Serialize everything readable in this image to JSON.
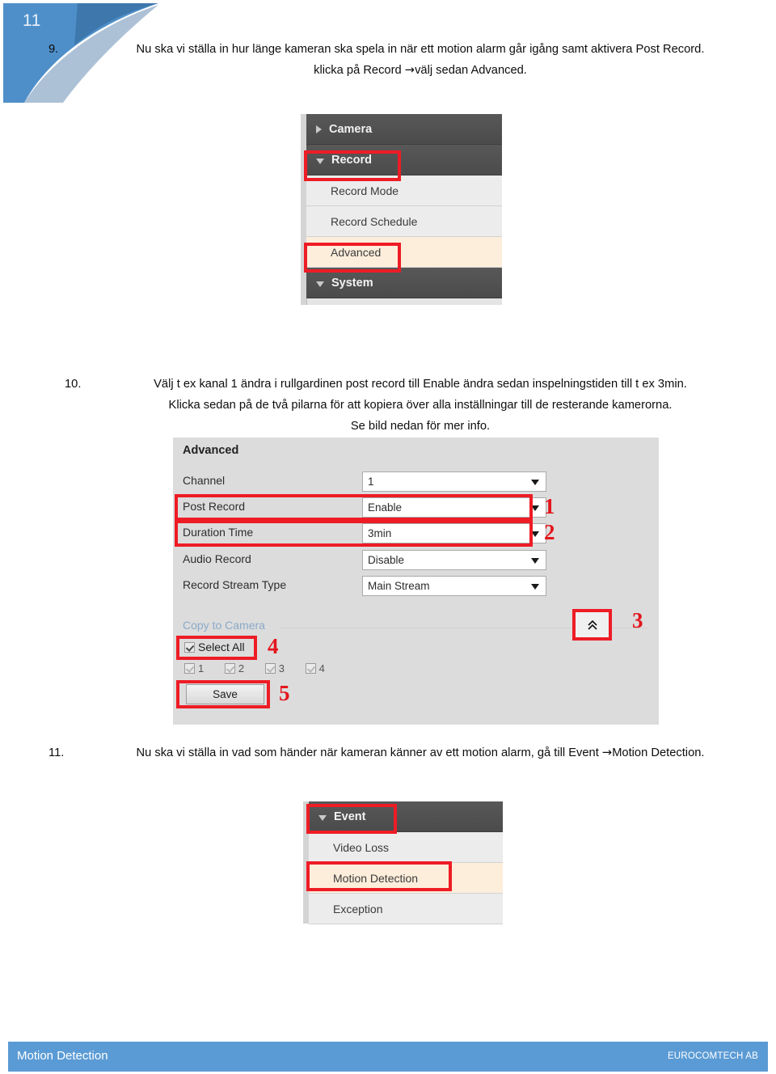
{
  "page": {
    "slide_number": "11"
  },
  "steps": {
    "nine": {
      "number": "9.",
      "line1": "Nu ska vi ställa in hur länge kameran ska spela in när ett motion alarm går igång samt aktivera Post Record.",
      "line2_before": "klicka på Record ",
      "line2_arrow": "→",
      "line2_after": "välj sedan Advanced."
    },
    "ten": {
      "number": "10.",
      "line1": "Välj t ex kanal 1 ändra i rullgardinen post record till Enable ändra sedan inspelningstiden till t ex 3min.",
      "line2": "Klicka sedan på de två pilarna för att kopiera över alla inställningar till de resterande kamerorna.",
      "line3": "Se bild nedan för mer info."
    },
    "eleven": {
      "number": "11.",
      "line1_before": "Nu ska vi ställa in vad som händer när kameran känner av ett motion alarm, gå till Event ",
      "line1_arrow": "→",
      "line1_after": "Motion Detection."
    }
  },
  "record_menu": {
    "items": [
      {
        "label": "Camera",
        "type": "group",
        "arrow": "right-triangle-icon",
        "highlighted": false
      },
      {
        "label": "Record",
        "type": "group",
        "arrow": "down-triangle-icon",
        "highlighted": true
      },
      {
        "label": "Record Mode",
        "type": "leaf",
        "active": false,
        "highlighted": false
      },
      {
        "label": "Record Schedule",
        "type": "leaf",
        "active": false,
        "highlighted": false
      },
      {
        "label": "Advanced",
        "type": "leaf",
        "active": true,
        "highlighted": true
      },
      {
        "label": "System",
        "type": "group",
        "arrow": "down-triangle-icon",
        "highlighted": false
      }
    ]
  },
  "event_menu": {
    "items": [
      {
        "label": "Event",
        "type": "group",
        "arrow": "down-triangle-icon",
        "highlighted": true
      },
      {
        "label": "Video Loss",
        "type": "leaf",
        "active": false,
        "highlighted": false
      },
      {
        "label": "Motion Detection",
        "type": "leaf",
        "active": true,
        "highlighted": true
      },
      {
        "label": "Exception",
        "type": "leaf",
        "active": false,
        "highlighted": false
      }
    ]
  },
  "advanced_dialog": {
    "title": "Advanced",
    "fields": [
      {
        "label": "Channel",
        "value": "1",
        "highlighted": false
      },
      {
        "label": "Post Record",
        "value": "Enable",
        "highlighted": true
      },
      {
        "label": "Duration Time",
        "value": "3min",
        "highlighted": true
      },
      {
        "label": "Audio Record",
        "value": "Disable",
        "highlighted": false
      },
      {
        "label": "Record Stream Type",
        "value": "Main Stream",
        "highlighted": false
      }
    ],
    "copy_to_camera_label": "Copy to Camera",
    "collapse_icon": "double-chevron-up-icon",
    "select_all_label": "Select All",
    "channel_checkboxes": [
      "1",
      "2",
      "3",
      "4"
    ],
    "save_label": "Save",
    "markers": [
      "1",
      "2",
      "3",
      "4",
      "5"
    ]
  },
  "footer": {
    "left": "Motion Detection",
    "right": "EUROCOMTECH AB"
  },
  "colors": {
    "accent_blue": "#5b9bd5",
    "highlight_red": "#ee1c25",
    "active_row": "#fdeedb"
  }
}
